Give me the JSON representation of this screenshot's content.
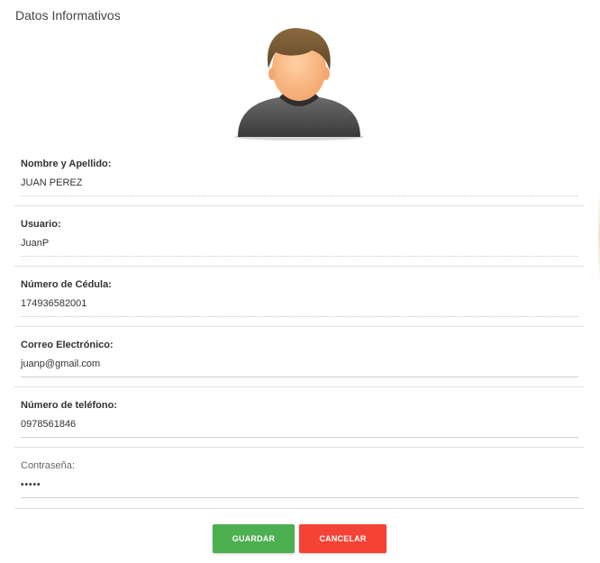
{
  "page": {
    "title": "Datos Informativos"
  },
  "avatar": {
    "icon": "user-avatar-icon"
  },
  "fields": [
    {
      "label": "Nombre y Apellido:",
      "value": "JUAN PEREZ"
    },
    {
      "label": "Usuario:",
      "value": "JuanP"
    },
    {
      "label": "Número de Cédula:",
      "value": "174936582001"
    },
    {
      "label": "Correo Electrónico:",
      "value": "juanp@gmail.com"
    },
    {
      "label": "Número de teléfono:",
      "value": "0978561846"
    },
    {
      "label": "Contraseña:",
      "value": "•••••"
    }
  ],
  "actions": {
    "save_label": "GUARDAR",
    "cancel_label": "CANCELAR"
  },
  "colors": {
    "save": "#4caf50",
    "cancel": "#f44336"
  }
}
